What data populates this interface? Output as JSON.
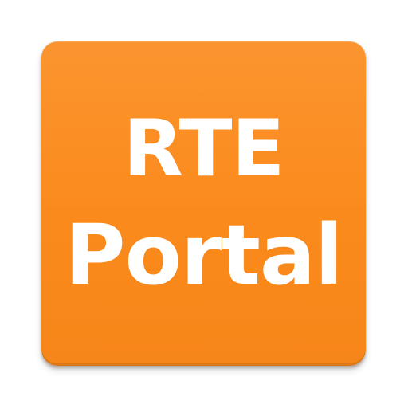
{
  "app_icon": {
    "line1": "RTE",
    "line2": "Portal",
    "background_color": "#fb8c1f",
    "text_color": "#ffffff"
  }
}
